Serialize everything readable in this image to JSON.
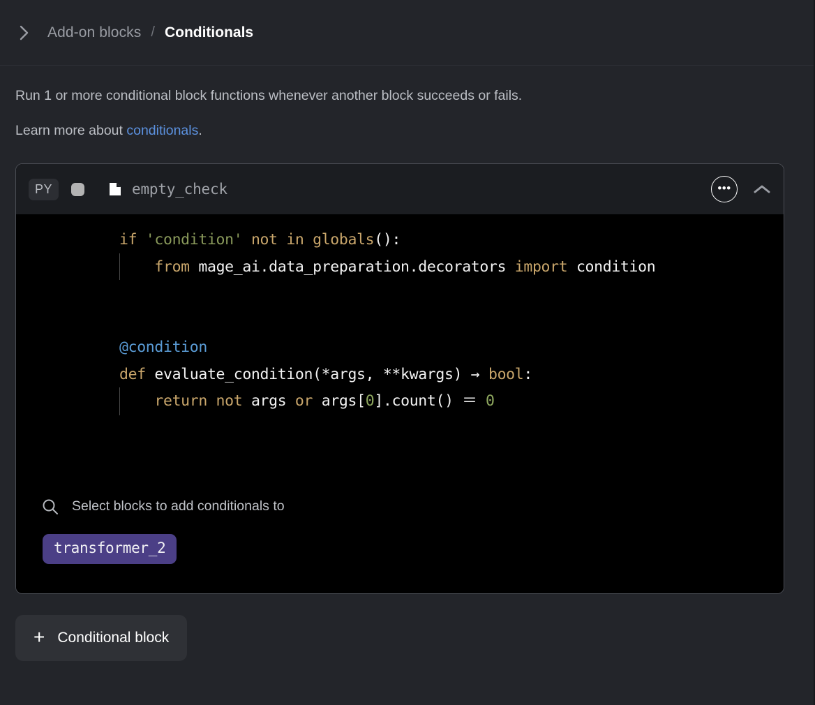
{
  "breadcrumb": {
    "expand_icon": "chevron-right-icon",
    "parent": "Add-on blocks",
    "separator": "/",
    "current": "Conditionals"
  },
  "description": {
    "line1": "Run 1 or more conditional block functions whenever another block succeeds or fails.",
    "line2_prefix": "Learn more about ",
    "link_text": "conditionals",
    "line2_suffix": ".",
    "link_color": "#5c92e0"
  },
  "block": {
    "language_badge": "PY",
    "status_icon": "status-square-icon",
    "file_icon": "file-icon",
    "name": "empty_check",
    "menu_icon": "ellipsis-icon",
    "collapse_icon": "chevron-up-icon",
    "code": {
      "lines": [
        [
          {
            "t": "if ",
            "c": "kw"
          },
          {
            "t": "'condition'",
            "c": "str"
          },
          {
            "t": " not in ",
            "c": "kw"
          },
          {
            "t": "globals",
            "c": "fn"
          },
          {
            "t": "():",
            "c": "id"
          }
        ],
        [
          {
            "t": "    ",
            "c": "id"
          },
          {
            "t": "from ",
            "c": "kw"
          },
          {
            "t": "mage_ai.data_preparation.decorators ",
            "c": "id"
          },
          {
            "t": "import ",
            "c": "kw"
          },
          {
            "t": "condition",
            "c": "id"
          }
        ],
        [],
        [],
        [
          {
            "t": "@condition",
            "c": "dec"
          }
        ],
        [
          {
            "t": "def ",
            "c": "kw"
          },
          {
            "t": "evaluate_condition(*args, **kwargs) ",
            "c": "id"
          },
          {
            "t": "→ ",
            "c": "id"
          },
          {
            "t": "bool",
            "c": "fn"
          },
          {
            "t": ":",
            "c": "id"
          }
        ],
        [
          {
            "t": "    ",
            "c": "id"
          },
          {
            "t": "return not ",
            "c": "kw"
          },
          {
            "t": "args ",
            "c": "id"
          },
          {
            "t": "or ",
            "c": "kw"
          },
          {
            "t": "args[",
            "c": "id"
          },
          {
            "t": "0",
            "c": "num"
          },
          {
            "t": "].count() ",
            "c": "id"
          },
          {
            "t": "＝ ",
            "c": "id"
          },
          {
            "t": "0",
            "c": "num"
          }
        ]
      ],
      "raw": "if 'condition' not in globals():\n    from mage_ai.data_preparation.decorators import condition\n\n\n@condition\ndef evaluate_condition(*args, **kwargs) -> bool:\n    return not args or args[0].count() == 0"
    },
    "search": {
      "icon": "search-icon",
      "placeholder": "Select blocks to add conditionals to",
      "value": ""
    },
    "selected_blocks": [
      {
        "label": "transformer_2",
        "color": "#4b3f86"
      }
    ]
  },
  "footer": {
    "add_icon": "plus-icon",
    "add_label": "Conditional block"
  }
}
